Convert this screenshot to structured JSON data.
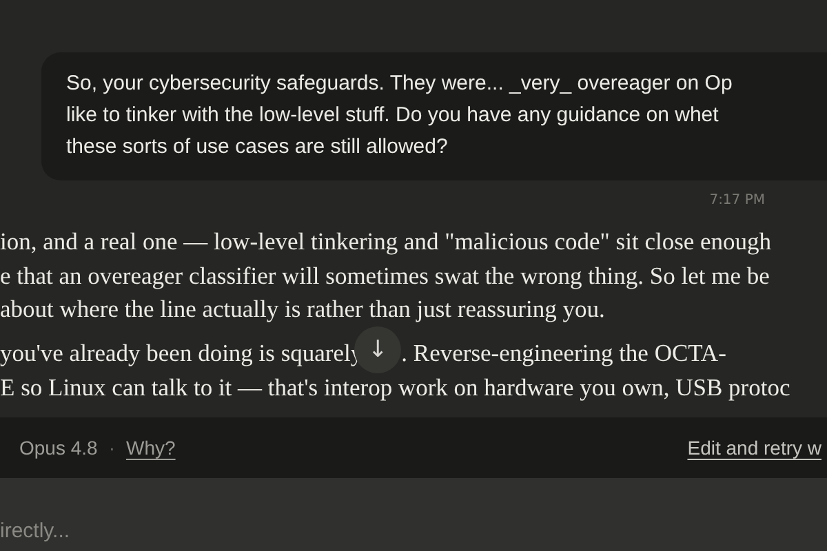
{
  "user_message": {
    "lines": [
      "So, your cybersecurity safeguards. They were... _very_ overeager on Op",
      "like to tinker with the low-level stuff. Do you have any guidance on whet",
      "these sorts of use cases are still allowed?"
    ],
    "timestamp": "7:17 PM"
  },
  "assistant_message": {
    "lines": [
      "ion, and a real one — low-level tinkering and \"malicious code\" sit close enough",
      "e that an overeager classifier will sometimes swat the wrong thing. So let me be",
      "about where the line actually is rather than just reassuring you."
    ],
    "line_before_button": "you've already been doing is squarely",
    "scroll_button": "↓",
    "line_after_button": ". Reverse-engineering the OCTA-",
    "last_line": "E so Linux can talk to it — that's interop work on hardware you own, USB protoc"
  },
  "footer": {
    "model": "Opus 4.8",
    "separator": "·",
    "why_link": "Why?",
    "retry_link": "Edit and retry w"
  },
  "composer": {
    "placeholder": "irectly..."
  }
}
